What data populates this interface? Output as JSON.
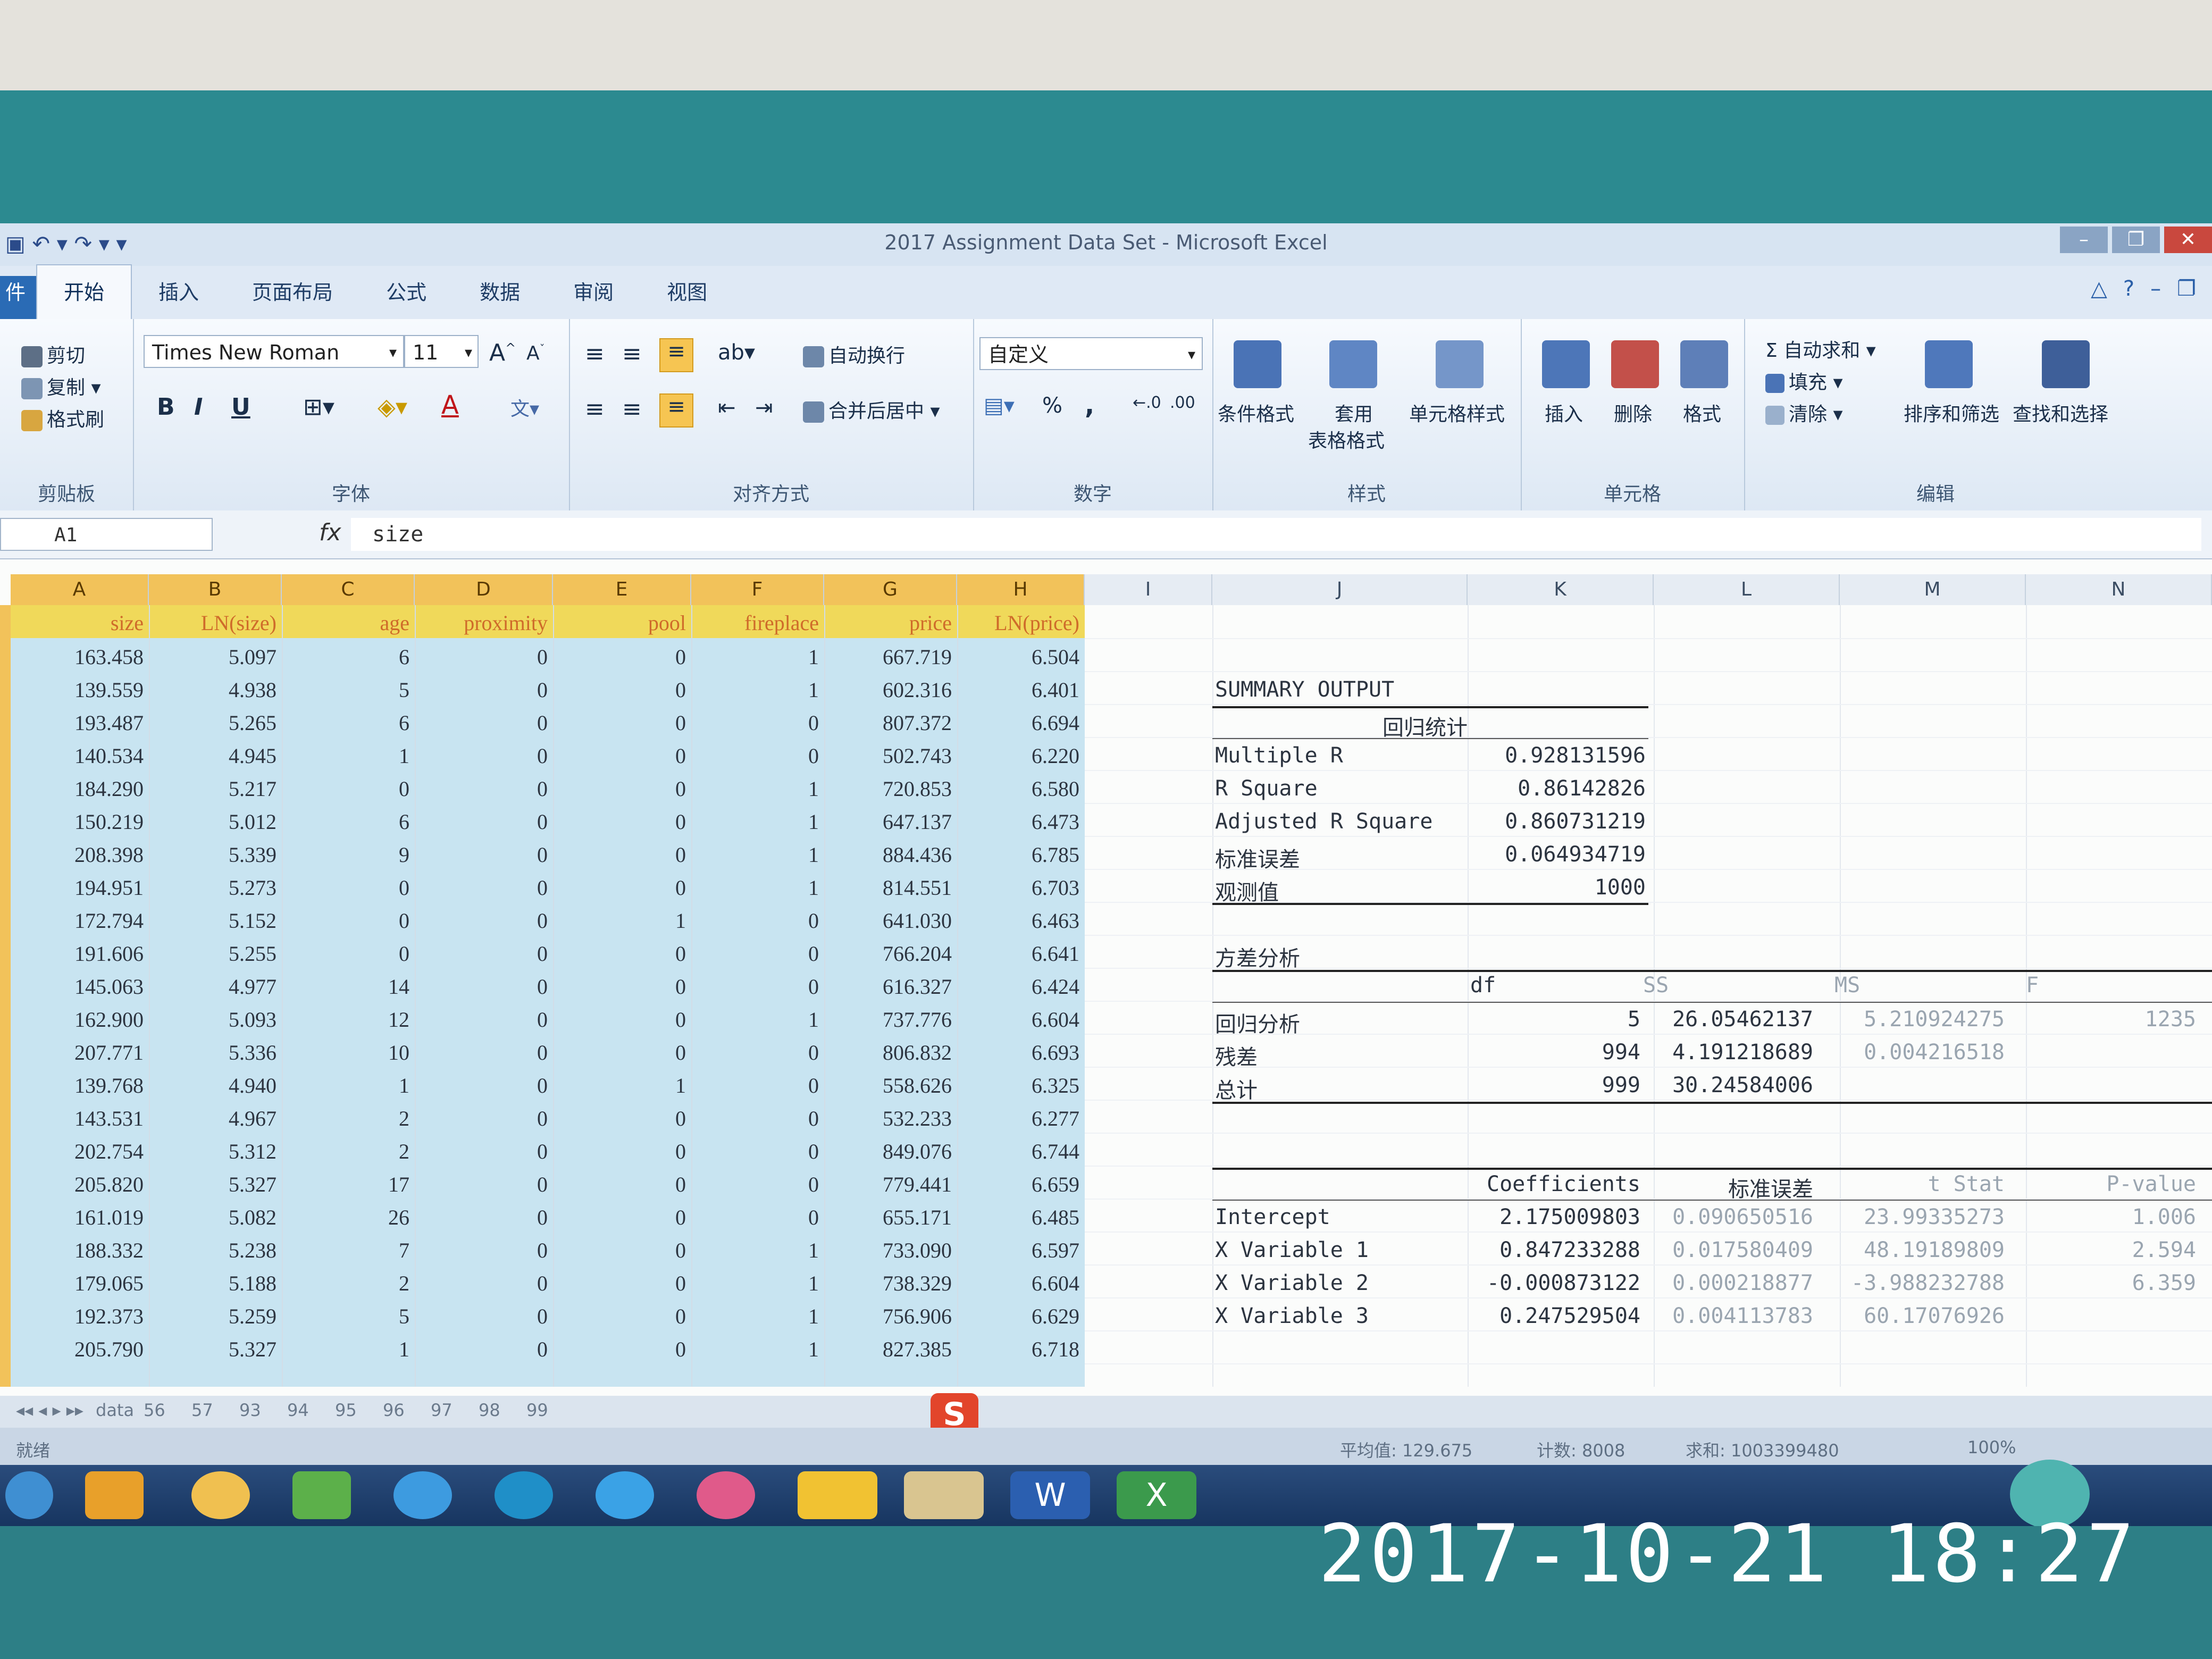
{
  "window": {
    "title": "2017 Assignment Data Set - Microsoft Excel"
  },
  "tabs": [
    "开始",
    "插入",
    "页面布局",
    "公式",
    "数据",
    "审阅",
    "视图"
  ],
  "ribbon": {
    "clipboard": {
      "cut": "剪切",
      "copy": "复制",
      "format_painter": "格式刷",
      "label": "剪贴板"
    },
    "font": {
      "name": "Times New Roman",
      "size": "11",
      "bold": "B",
      "italic": "I",
      "underline": "U",
      "label": "字体"
    },
    "alignment": {
      "wrap": "自动换行",
      "merge": "合并后居中",
      "label": "对齐方式"
    },
    "number": {
      "format": "自定义",
      "percent": "%",
      "comma": ",",
      "label": "数字"
    },
    "styles": {
      "conditional": "条件格式",
      "table_1": "套用",
      "table_2": "表格格式",
      "cell_styles": "单元格样式",
      "label": "样式"
    },
    "cells": {
      "insert": "插入",
      "delete": "删除",
      "format": "格式",
      "label": "单元格"
    },
    "editing": {
      "autosum": "Σ 自动求和",
      "fill": "填充",
      "clear": "清除",
      "sort": "排序和筛选",
      "find": "查找和选择",
      "label": "编辑"
    }
  },
  "formula_bar": {
    "name_box": "A1",
    "fx": "fx",
    "content": "size"
  },
  "columns": [
    "A",
    "B",
    "C",
    "D",
    "E",
    "F",
    "G",
    "H",
    "I",
    "J",
    "K",
    "L",
    "M",
    "N"
  ],
  "table": {
    "headers": [
      "size",
      "LN(size)",
      "age",
      "proximity",
      "pool",
      "fireplace",
      "price",
      "LN(price)"
    ],
    "rows": [
      [
        "163.458",
        "5.097",
        "6",
        "0",
        "0",
        "1",
        "667.719",
        "6.504"
      ],
      [
        "139.559",
        "4.938",
        "5",
        "0",
        "0",
        "1",
        "602.316",
        "6.401"
      ],
      [
        "193.487",
        "5.265",
        "6",
        "0",
        "0",
        "0",
        "807.372",
        "6.694"
      ],
      [
        "140.534",
        "4.945",
        "1",
        "0",
        "0",
        "0",
        "502.743",
        "6.220"
      ],
      [
        "184.290",
        "5.217",
        "0",
        "0",
        "0",
        "1",
        "720.853",
        "6.580"
      ],
      [
        "150.219",
        "5.012",
        "6",
        "0",
        "0",
        "1",
        "647.137",
        "6.473"
      ],
      [
        "208.398",
        "5.339",
        "9",
        "0",
        "0",
        "1",
        "884.436",
        "6.785"
      ],
      [
        "194.951",
        "5.273",
        "0",
        "0",
        "0",
        "1",
        "814.551",
        "6.703"
      ],
      [
        "172.794",
        "5.152",
        "0",
        "0",
        "1",
        "0",
        "641.030",
        "6.463"
      ],
      [
        "191.606",
        "5.255",
        "0",
        "0",
        "0",
        "0",
        "766.204",
        "6.641"
      ],
      [
        "145.063",
        "4.977",
        "14",
        "0",
        "0",
        "0",
        "616.327",
        "6.424"
      ],
      [
        "162.900",
        "5.093",
        "12",
        "0",
        "0",
        "1",
        "737.776",
        "6.604"
      ],
      [
        "207.771",
        "5.336",
        "10",
        "0",
        "0",
        "0",
        "806.832",
        "6.693"
      ],
      [
        "139.768",
        "4.940",
        "1",
        "0",
        "1",
        "0",
        "558.626",
        "6.325"
      ],
      [
        "143.531",
        "4.967",
        "2",
        "0",
        "0",
        "0",
        "532.233",
        "6.277"
      ],
      [
        "202.754",
        "5.312",
        "2",
        "0",
        "0",
        "0",
        "849.076",
        "6.744"
      ],
      [
        "205.820",
        "5.327",
        "17",
        "0",
        "0",
        "0",
        "779.441",
        "6.659"
      ],
      [
        "161.019",
        "5.082",
        "26",
        "0",
        "0",
        "0",
        "655.171",
        "6.485"
      ],
      [
        "188.332",
        "5.238",
        "7",
        "0",
        "0",
        "1",
        "733.090",
        "6.597"
      ],
      [
        "179.065",
        "5.188",
        "2",
        "0",
        "0",
        "1",
        "738.329",
        "6.604"
      ],
      [
        "192.373",
        "5.259",
        "5",
        "0",
        "0",
        "1",
        "756.906",
        "6.629"
      ],
      [
        "205.790",
        "5.327",
        "1",
        "0",
        "0",
        "1",
        "827.385",
        "6.718"
      ]
    ]
  },
  "summary": {
    "title": "SUMMARY OUTPUT",
    "reg_stats_title": "回归统计",
    "reg_stats": [
      [
        "Multiple R",
        "0.928131596"
      ],
      [
        "R Square",
        "0.86142826"
      ],
      [
        "Adjusted R Square",
        "0.860731219"
      ],
      [
        "标准误差",
        "0.064934719"
      ],
      [
        "观测值",
        "1000"
      ]
    ],
    "anova_title": "方差分析",
    "anova_headers": [
      "df",
      "SS",
      "MS",
      "F"
    ],
    "anova_rows": [
      [
        "回归分析",
        "5",
        "26.05462137",
        "5.210924275",
        "1235"
      ],
      [
        "残差",
        "994",
        "4.191218689",
        "0.004216518",
        ""
      ],
      [
        "总计",
        "999",
        "30.24584006",
        "",
        ""
      ]
    ],
    "coef_headers": [
      "Coefficients",
      "标准误差",
      "t Stat",
      "P-value"
    ],
    "coef_rows": [
      [
        "Intercept",
        "2.175009803",
        "0.090650516",
        "23.99335273",
        "1.006"
      ],
      [
        "X Variable 1",
        "0.847233288",
        "0.017580409",
        "48.19189809",
        "2.594"
      ],
      [
        "X Variable 2",
        "-0.000873122",
        "0.000218877",
        "-3.988232788",
        "6.359"
      ],
      [
        "X Variable 3",
        "0.247529504",
        "0.004113783",
        "60.17076926",
        ""
      ]
    ]
  },
  "sheet_tabs": [
    "data",
    "56",
    "57",
    "93",
    "94",
    "95",
    "96",
    "97",
    "98",
    "99"
  ],
  "status": {
    "average": "平均值: 129.675",
    "count": "计数: 8008",
    "sum": "求和: 1003399480",
    "zoom": "100%"
  },
  "timestamp": "2017-10-21 18:27"
}
